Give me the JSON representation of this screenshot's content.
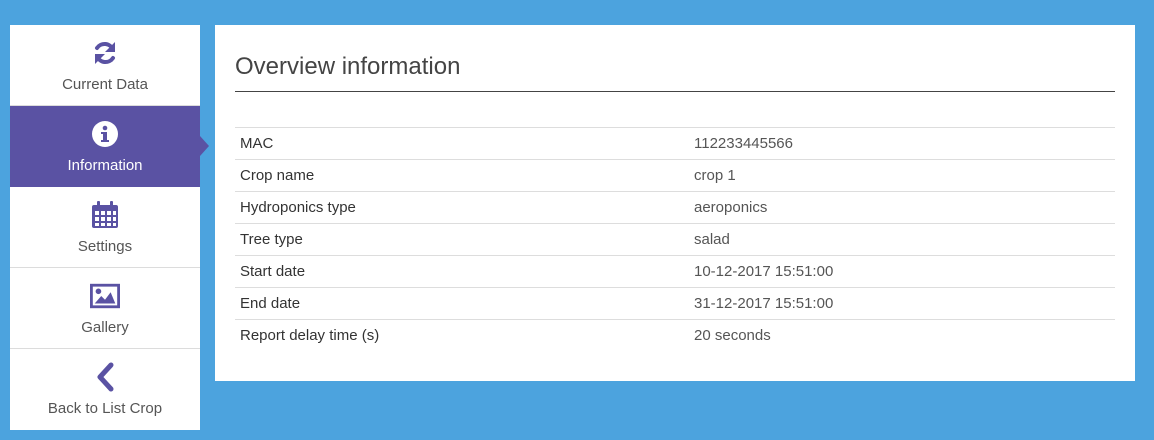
{
  "sidebar": {
    "items": [
      {
        "label": "Current Data",
        "icon": "refresh-icon"
      },
      {
        "label": "Information",
        "icon": "info-icon",
        "active": true
      },
      {
        "label": "Settings",
        "icon": "calendar-icon"
      },
      {
        "label": "Gallery",
        "icon": "image-icon"
      },
      {
        "label": "Back to List Crop",
        "icon": "chevron-left-icon"
      }
    ]
  },
  "main": {
    "title": "Overview information",
    "rows": [
      {
        "key": "MAC",
        "value": "112233445566"
      },
      {
        "key": "Crop name",
        "value": "crop 1"
      },
      {
        "key": "Hydroponics type",
        "value": "aeroponics"
      },
      {
        "key": "Tree type",
        "value": "salad"
      },
      {
        "key": "Start date",
        "value": "10-12-2017 15:51:00"
      },
      {
        "key": "End date",
        "value": "31-12-2017 15:51:00"
      },
      {
        "key": "Report delay time (s)",
        "value": "20 seconds"
      }
    ]
  },
  "colors": {
    "background": "#4ca3de",
    "accent": "#5a52a3"
  }
}
